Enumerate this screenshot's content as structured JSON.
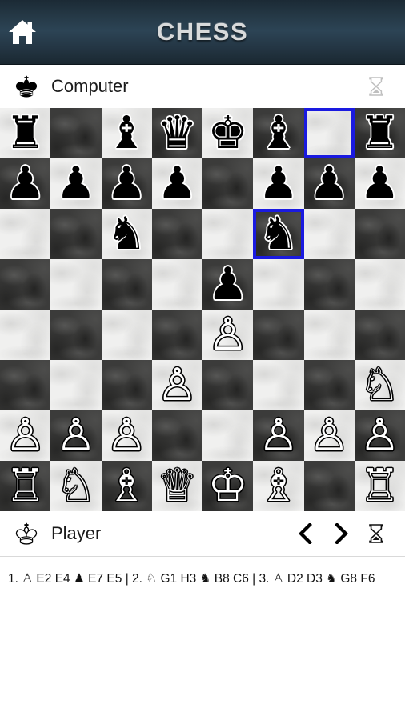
{
  "header": {
    "title": "CHESS",
    "home_icon": "home-icon",
    "background_color": "#2c4455"
  },
  "top_player": {
    "icon": "black-king-icon",
    "name": "Computer",
    "hourglass_icon": "hourglass-icon",
    "hourglass_active": false
  },
  "bottom_player": {
    "icon": "white-king-icon",
    "name": "Player",
    "prev_icon": "chevron-left-icon",
    "next_icon": "chevron-right-icon",
    "hourglass_icon": "hourglass-icon",
    "hourglass_active": true
  },
  "board": {
    "highlight_color": "#1a1ae0",
    "light_square_color": "#f0f0ef",
    "dark_square_color": "#3b3b3a",
    "selected_squares": [
      "g8",
      "f6"
    ],
    "ranks": [
      {
        "rank": "8",
        "squares": [
          {
            "file": "a",
            "piece": "r",
            "color": "b",
            "selected": false
          },
          {
            "file": "b",
            "piece": "",
            "color": "",
            "selected": false
          },
          {
            "file": "c",
            "piece": "b",
            "color": "b",
            "selected": false
          },
          {
            "file": "d",
            "piece": "q",
            "color": "b",
            "selected": false
          },
          {
            "file": "e",
            "piece": "k",
            "color": "b",
            "selected": false
          },
          {
            "file": "f",
            "piece": "b",
            "color": "b",
            "selected": false
          },
          {
            "file": "g",
            "piece": "",
            "color": "",
            "selected": true
          },
          {
            "file": "h",
            "piece": "r",
            "color": "b",
            "selected": false
          }
        ]
      },
      {
        "rank": "7",
        "squares": [
          {
            "file": "a",
            "piece": "p",
            "color": "b",
            "selected": false
          },
          {
            "file": "b",
            "piece": "p",
            "color": "b",
            "selected": false
          },
          {
            "file": "c",
            "piece": "p",
            "color": "b",
            "selected": false
          },
          {
            "file": "d",
            "piece": "p",
            "color": "b",
            "selected": false
          },
          {
            "file": "e",
            "piece": "",
            "color": "",
            "selected": false
          },
          {
            "file": "f",
            "piece": "p",
            "color": "b",
            "selected": false
          },
          {
            "file": "g",
            "piece": "p",
            "color": "b",
            "selected": false
          },
          {
            "file": "h",
            "piece": "p",
            "color": "b",
            "selected": false
          }
        ]
      },
      {
        "rank": "6",
        "squares": [
          {
            "file": "a",
            "piece": "",
            "color": "",
            "selected": false
          },
          {
            "file": "b",
            "piece": "",
            "color": "",
            "selected": false
          },
          {
            "file": "c",
            "piece": "n",
            "color": "b",
            "selected": false
          },
          {
            "file": "d",
            "piece": "",
            "color": "",
            "selected": false
          },
          {
            "file": "e",
            "piece": "",
            "color": "",
            "selected": false
          },
          {
            "file": "f",
            "piece": "n",
            "color": "b",
            "selected": true
          },
          {
            "file": "g",
            "piece": "",
            "color": "",
            "selected": false
          },
          {
            "file": "h",
            "piece": "",
            "color": "",
            "selected": false
          }
        ]
      },
      {
        "rank": "5",
        "squares": [
          {
            "file": "a",
            "piece": "",
            "color": "",
            "selected": false
          },
          {
            "file": "b",
            "piece": "",
            "color": "",
            "selected": false
          },
          {
            "file": "c",
            "piece": "",
            "color": "",
            "selected": false
          },
          {
            "file": "d",
            "piece": "",
            "color": "",
            "selected": false
          },
          {
            "file": "e",
            "piece": "p",
            "color": "b",
            "selected": false
          },
          {
            "file": "f",
            "piece": "",
            "color": "",
            "selected": false
          },
          {
            "file": "g",
            "piece": "",
            "color": "",
            "selected": false
          },
          {
            "file": "h",
            "piece": "",
            "color": "",
            "selected": false
          }
        ]
      },
      {
        "rank": "4",
        "squares": [
          {
            "file": "a",
            "piece": "",
            "color": "",
            "selected": false
          },
          {
            "file": "b",
            "piece": "",
            "color": "",
            "selected": false
          },
          {
            "file": "c",
            "piece": "",
            "color": "",
            "selected": false
          },
          {
            "file": "d",
            "piece": "",
            "color": "",
            "selected": false
          },
          {
            "file": "e",
            "piece": "p",
            "color": "w",
            "selected": false
          },
          {
            "file": "f",
            "piece": "",
            "color": "",
            "selected": false
          },
          {
            "file": "g",
            "piece": "",
            "color": "",
            "selected": false
          },
          {
            "file": "h",
            "piece": "",
            "color": "",
            "selected": false
          }
        ]
      },
      {
        "rank": "3",
        "squares": [
          {
            "file": "a",
            "piece": "",
            "color": "",
            "selected": false
          },
          {
            "file": "b",
            "piece": "",
            "color": "",
            "selected": false
          },
          {
            "file": "c",
            "piece": "",
            "color": "",
            "selected": false
          },
          {
            "file": "d",
            "piece": "p",
            "color": "w",
            "selected": false
          },
          {
            "file": "e",
            "piece": "",
            "color": "",
            "selected": false
          },
          {
            "file": "f",
            "piece": "",
            "color": "",
            "selected": false
          },
          {
            "file": "g",
            "piece": "",
            "color": "",
            "selected": false
          },
          {
            "file": "h",
            "piece": "n",
            "color": "w",
            "selected": false
          }
        ]
      },
      {
        "rank": "2",
        "squares": [
          {
            "file": "a",
            "piece": "p",
            "color": "w",
            "selected": false
          },
          {
            "file": "b",
            "piece": "p",
            "color": "w",
            "selected": false
          },
          {
            "file": "c",
            "piece": "p",
            "color": "w",
            "selected": false
          },
          {
            "file": "d",
            "piece": "",
            "color": "",
            "selected": false
          },
          {
            "file": "e",
            "piece": "",
            "color": "",
            "selected": false
          },
          {
            "file": "f",
            "piece": "p",
            "color": "w",
            "selected": false
          },
          {
            "file": "g",
            "piece": "p",
            "color": "w",
            "selected": false
          },
          {
            "file": "h",
            "piece": "p",
            "color": "w",
            "selected": false
          }
        ]
      },
      {
        "rank": "1",
        "squares": [
          {
            "file": "a",
            "piece": "r",
            "color": "w",
            "selected": false
          },
          {
            "file": "b",
            "piece": "n",
            "color": "w",
            "selected": false
          },
          {
            "file": "c",
            "piece": "b",
            "color": "w",
            "selected": false
          },
          {
            "file": "d",
            "piece": "q",
            "color": "w",
            "selected": false
          },
          {
            "file": "e",
            "piece": "k",
            "color": "w",
            "selected": false
          },
          {
            "file": "f",
            "piece": "b",
            "color": "w",
            "selected": false
          },
          {
            "file": "g",
            "piece": "",
            "color": "",
            "selected": false
          },
          {
            "file": "h",
            "piece": "r",
            "color": "w",
            "selected": false
          }
        ]
      }
    ]
  },
  "move_list": {
    "text": "1. ♙ E2 E4 ♟ E7 E5 | 2. ♘ G1 H3 ♞ B8 C6 | 3. ♙ D2 D3 ♞ G8 F6",
    "moves": [
      {
        "number": "1.",
        "white": "♙ E2 E4",
        "black": "♟ E7 E5"
      },
      {
        "number": "2.",
        "white": "♘ G1 H3",
        "black": "♞ B8 C6"
      },
      {
        "number": "3.",
        "white": "♙ D2 D3",
        "black": "♞ G8 F6"
      }
    ]
  },
  "glyphs": {
    "k_w": "♔",
    "q_w": "♕",
    "r_w": "♖",
    "b_w": "♗",
    "n_w": "♘",
    "p_w": "♙",
    "k_b": "♚",
    "q_b": "♛",
    "r_b": "♜",
    "b_b": "♝",
    "n_b": "♞",
    "p_b": "♟"
  }
}
